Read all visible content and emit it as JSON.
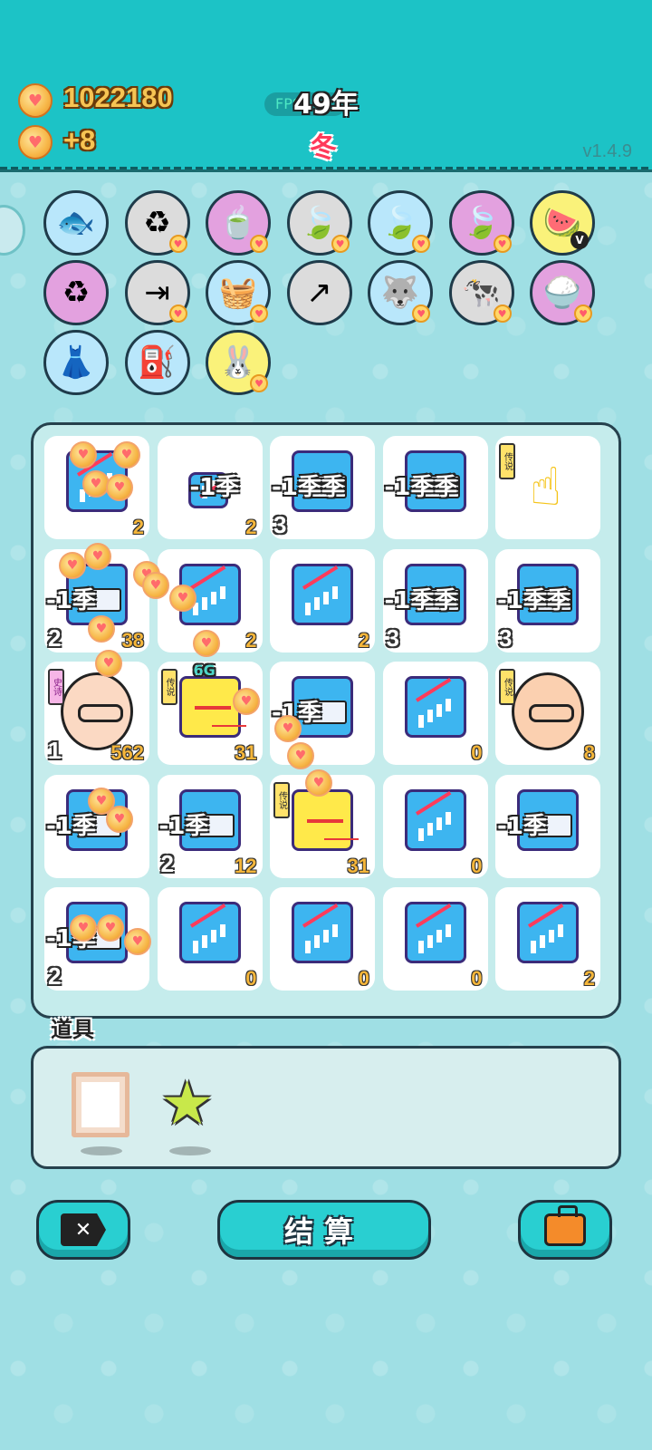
{
  "header": {
    "money": "1022180",
    "income": "+8",
    "fps_label": "FPS",
    "year": "49年",
    "season": "冬",
    "version": "v1.4.9"
  },
  "relics": [
    {
      "name": "fish-tank-icon",
      "bg": "#b9e7fb",
      "glyph": "🐟",
      "badge": false
    },
    {
      "name": "refresh-icon",
      "bg": "#dcdcdc",
      "glyph": "♻",
      "badge": true
    },
    {
      "name": "tea-pot-icon",
      "bg": "#e3a1df",
      "glyph": "🍵",
      "badge": true
    },
    {
      "name": "leaf-icon",
      "bg": "#dcdcdc",
      "glyph": "🍃",
      "badge": true
    },
    {
      "name": "leaf-icon",
      "bg": "#b9e7fb",
      "glyph": "🍃",
      "badge": true
    },
    {
      "name": "leaf-icon",
      "bg": "#e3a1df",
      "glyph": "🍃",
      "badge": true
    },
    {
      "name": "fruit-basket-icon",
      "bg": "#faf27a",
      "glyph": "🍉",
      "badge": false,
      "vip": true
    },
    {
      "name": "recycle-icon",
      "bg": "#e3a1df",
      "glyph": "♻",
      "badge": false
    },
    {
      "name": "skip-icon",
      "bg": "#dcdcdc",
      "glyph": "⇥",
      "badge": true
    },
    {
      "name": "apple-basket-icon",
      "bg": "#b9e7fb",
      "glyph": "🧺",
      "badge": true
    },
    {
      "name": "arrow-box-icon",
      "bg": "#dcdcdc",
      "glyph": "↗",
      "badge": false
    },
    {
      "name": "husky-icon",
      "bg": "#b9e7fb",
      "glyph": "🐺",
      "badge": true
    },
    {
      "name": "cow-icon",
      "bg": "#dcdcdc",
      "glyph": "🐄",
      "badge": true
    },
    {
      "name": "rice-bowl-icon",
      "bg": "#e3a1df",
      "glyph": "🍚",
      "badge": true
    },
    {
      "name": "skirt-icon",
      "bg": "#b9e7fb",
      "glyph": "👗",
      "badge": false
    },
    {
      "name": "pump-icon",
      "bg": "#b9e7fb",
      "glyph": "⛽",
      "badge": false
    },
    {
      "name": "rabbit-icon",
      "bg": "#faf27a",
      "glyph": "🐰",
      "badge": true
    }
  ],
  "board": {
    "cells": [
      {
        "type": "chart",
        "right": "2",
        "left": "",
        "tag": "",
        "float": ""
      },
      {
        "type": "chart-small",
        "right": "2",
        "left": "",
        "tag": "",
        "float": "-1季"
      },
      {
        "type": "gold",
        "right": "",
        "left": "3",
        "tag": "",
        "float": "-1季季"
      },
      {
        "type": "gold",
        "right": "",
        "left": "",
        "tag": "",
        "float": "-1季季"
      },
      {
        "type": "hand",
        "right": "",
        "left": "",
        "tag": "传说",
        "float": ""
      },
      {
        "type": "gold",
        "right": "38",
        "left": "2",
        "tag": "",
        "float": "-1季"
      },
      {
        "type": "chart",
        "right": "2",
        "left": "",
        "tag": "",
        "float": ""
      },
      {
        "type": "chart",
        "right": "2",
        "left": "",
        "tag": "",
        "float": ""
      },
      {
        "type": "gold",
        "right": "",
        "left": "3",
        "tag": "",
        "float": "-1季季"
      },
      {
        "type": "gold",
        "right": "",
        "left": "3",
        "tag": "",
        "float": "-1季季"
      },
      {
        "type": "face",
        "right": "562",
        "left": "1",
        "tag": "史诗",
        "float": ""
      },
      {
        "type": "scale",
        "right": "31",
        "left": "",
        "tag": "传说",
        "float": "6G"
      },
      {
        "type": "gold",
        "right": "",
        "left": "",
        "tag": "",
        "float": "-1季"
      },
      {
        "type": "chart",
        "right": "0",
        "left": "",
        "tag": "",
        "float": ""
      },
      {
        "type": "bald",
        "right": "8",
        "left": "",
        "tag": "传说",
        "float": ""
      },
      {
        "type": "gold",
        "right": "",
        "left": "",
        "tag": "",
        "float": "-1季"
      },
      {
        "type": "gold",
        "right": "12",
        "left": "2",
        "tag": "",
        "float": "-1季"
      },
      {
        "type": "scale",
        "right": "31",
        "left": "",
        "tag": "传说",
        "float": ""
      },
      {
        "type": "chart",
        "right": "0",
        "left": "",
        "tag": "",
        "float": ""
      },
      {
        "type": "gold",
        "right": "",
        "left": "",
        "tag": "",
        "float": "-1季"
      },
      {
        "type": "gold",
        "right": "",
        "left": "2",
        "tag": "",
        "float": "-1季"
      },
      {
        "type": "chart",
        "right": "0",
        "left": "",
        "tag": "",
        "float": ""
      },
      {
        "type": "chart",
        "right": "0",
        "left": "",
        "tag": "",
        "float": ""
      },
      {
        "type": "chart",
        "right": "0",
        "left": "",
        "tag": "",
        "float": ""
      },
      {
        "type": "chart",
        "right": "2",
        "left": "",
        "tag": "",
        "float": ""
      }
    ]
  },
  "items": {
    "label": "道具",
    "list": [
      {
        "name": "frame-item-icon"
      },
      {
        "name": "star-item-icon"
      }
    ]
  },
  "buttons": {
    "exit_glyph": "✕",
    "settle_label": "结算"
  },
  "colors": {
    "header": "#1cc3c6",
    "background": "#9fdfe4",
    "button": "#29cfd1",
    "coin": "#f7b748"
  }
}
